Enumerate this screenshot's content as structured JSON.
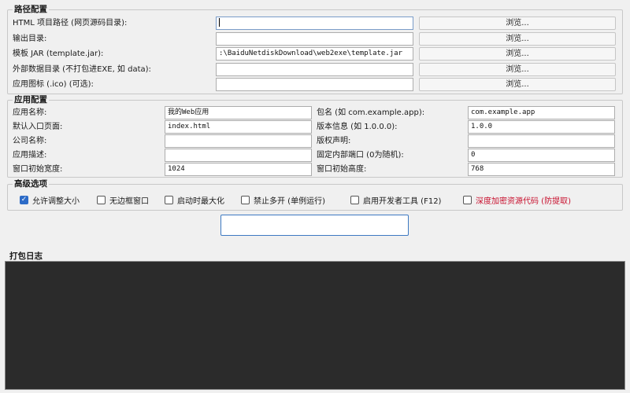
{
  "paths": {
    "title": "路径配置",
    "browse_label": "浏览...",
    "rows": [
      {
        "label": "HTML 项目路径 (网页源码目录):",
        "value": ""
      },
      {
        "label": "输出目录:",
        "value": ""
      },
      {
        "label": "模板 JAR (template.jar):",
        "value": ":\\BaiduNetdiskDownload\\web2exe\\template.jar"
      },
      {
        "label": "外部数据目录 (不打包进EXE, 如 data):",
        "value": ""
      },
      {
        "label": "应用图标 (.ico) (可选):",
        "value": ""
      }
    ]
  },
  "app": {
    "title": "应用配置",
    "name_label": "应用名称:",
    "name_value": "我的Web应用",
    "package_label": "包名 (如 com.example.app):",
    "package_value": "com.example.app",
    "entry_label": "默认入口页面:",
    "entry_value": "index.html",
    "version_label": "版本信息 (如 1.0.0.0):",
    "version_value": "1.0.0",
    "company_label": "公司名称:",
    "company_value": "",
    "copyright_label": "版权声明:",
    "copyright_value": "",
    "desc_label": "应用描述:",
    "desc_value": "",
    "port_label": "固定内部端口 (0为随机):",
    "port_value": "0",
    "width_label": "窗口初始宽度:",
    "width_value": "1024",
    "height_label": "窗口初始高度:",
    "height_value": "768"
  },
  "advanced": {
    "title": "高级选项",
    "options": [
      {
        "label": "允许调整大小",
        "checked": true
      },
      {
        "label": "无边框窗口",
        "checked": false
      },
      {
        "label": "启动时最大化",
        "checked": false
      },
      {
        "label": "禁止多开 (单例运行)",
        "checked": false
      },
      {
        "label": "启用开发者工具 (F12)",
        "checked": false
      },
      {
        "label": "深度加密资源代码 (防提取)",
        "checked": false
      }
    ],
    "accent_color": "#2d6bc7",
    "warning_color": "#c8102e"
  },
  "action": {
    "build_label": ""
  },
  "log": {
    "title": "打包日志",
    "content": "",
    "background": "#2b2b2b"
  }
}
